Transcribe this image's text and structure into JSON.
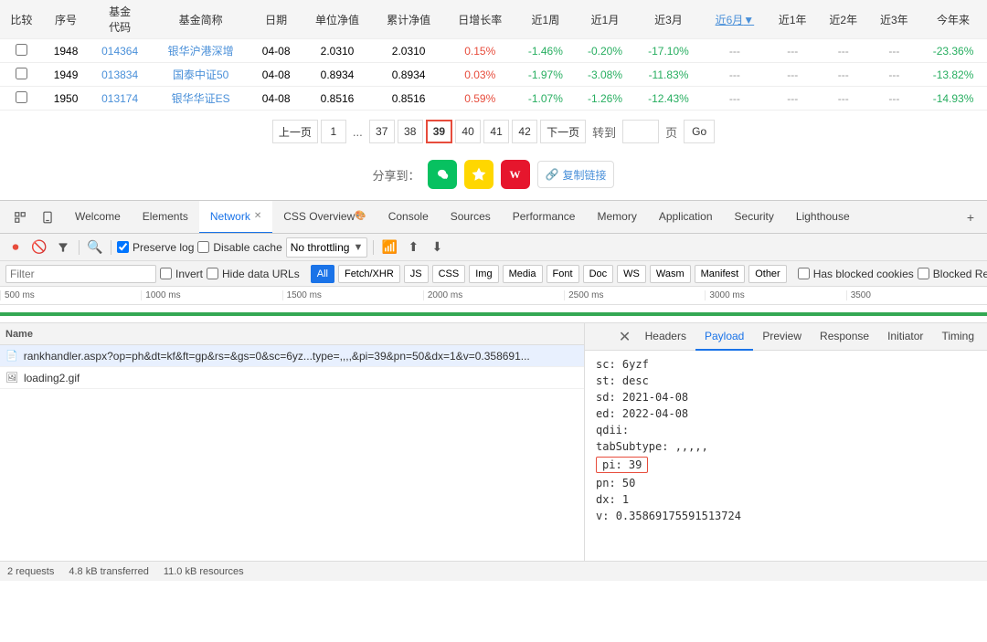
{
  "table": {
    "headers": [
      "比较",
      "序号",
      "基金代码",
      "基金简称",
      "日期",
      "单位净值",
      "累计净值",
      "日增长率",
      "近1周",
      "近1月",
      "近3月",
      "近6月",
      "近1年",
      "近2年",
      "近3年",
      "今年来"
    ],
    "rows": [
      {
        "compare": "",
        "seq": "1948",
        "code": "014364",
        "name": "银华沪港深增",
        "date": "04-08",
        "unit_nav": "2.0310",
        "accum_nav": "2.0310",
        "daily": "0.15%",
        "w1": "-1.46%",
        "m1": "-0.20%",
        "m3": "-17.10%",
        "m6": "---",
        "y1": "---",
        "y2": "---",
        "y3": "---",
        "ytd": "-23.36%"
      },
      {
        "compare": "",
        "seq": "1949",
        "code": "013834",
        "name": "国泰中证50",
        "date": "04-08",
        "unit_nav": "0.8934",
        "accum_nav": "0.8934",
        "daily": "0.03%",
        "w1": "-1.97%",
        "m1": "-3.08%",
        "m3": "-11.83%",
        "m6": "---",
        "y1": "---",
        "y2": "---",
        "y3": "---",
        "ytd": "-13.82%"
      },
      {
        "compare": "",
        "seq": "1950",
        "code": "013174",
        "name": "银华华证ES",
        "date": "04-08",
        "unit_nav": "0.8516",
        "accum_nav": "0.8516",
        "daily": "0.59%",
        "w1": "-1.07%",
        "m1": "-1.26%",
        "m3": "-12.43%",
        "m6": "---",
        "y1": "---",
        "y2": "---",
        "y3": "---",
        "ytd": "-14.93%"
      }
    ]
  },
  "pagination": {
    "prev": "上一页",
    "next": "下一页",
    "goto_label": "转到",
    "page_unit": "页",
    "go_btn": "Go",
    "pages": [
      "1",
      "...",
      "37",
      "38",
      "39",
      "40",
      "41",
      "42"
    ],
    "current": "39"
  },
  "share": {
    "label": "分享到：",
    "copy_text": "复制链接"
  },
  "devtools": {
    "tabs": [
      {
        "label": "Welcome",
        "active": false
      },
      {
        "label": "Elements",
        "active": false
      },
      {
        "label": "Network",
        "active": true,
        "closable": true
      },
      {
        "label": "CSS Overview",
        "active": false
      },
      {
        "label": "Console",
        "active": false
      },
      {
        "label": "Sources",
        "active": false
      },
      {
        "label": "Performance",
        "active": false
      },
      {
        "label": "Memory",
        "active": false
      },
      {
        "label": "Application",
        "active": false
      },
      {
        "label": "Security",
        "active": false
      },
      {
        "label": "Lighthouse",
        "active": false
      }
    ],
    "toolbar": {
      "preserve_log": "Preserve log",
      "disable_cache": "Disable cache",
      "throttling": "No throttling"
    },
    "filter": {
      "placeholder": "Filter",
      "invert": "Invert",
      "hide_data": "Hide data URLs",
      "all": "All",
      "fetch_xhr": "Fetch/XHR",
      "js": "JS",
      "css": "CSS",
      "img": "Img",
      "media": "Media",
      "font": "Font",
      "doc": "Doc",
      "ws": "WS",
      "wasm": "Wasm",
      "manifest": "Manifest",
      "other": "Other",
      "has_blocked": "Has blocked cookies",
      "blocked_re": "Blocked Re..."
    },
    "timeline": {
      "ticks": [
        "500 ms",
        "1000 ms",
        "1500 ms",
        "2000 ms",
        "2500 ms",
        "3000 ms",
        "3500"
      ]
    },
    "file_list": {
      "header": "Name",
      "files": [
        {
          "name": "rankhandler.aspx?op=ph&dt=kf&ft=gp&rs=&gs=0&sc=6yz...type=,,,,&pi=39&pn=50&dx=1&v=0.358691...",
          "type": "request",
          "selected": true
        },
        {
          "name": "loading2.gif",
          "type": "gif",
          "selected": false
        }
      ]
    },
    "details": {
      "tabs": [
        "Headers",
        "Payload",
        "Preview",
        "Response",
        "Initiator",
        "Timing"
      ],
      "active_tab": "Payload",
      "payload": {
        "sc": "6yzf",
        "st": "desc",
        "sd": "2021-04-08",
        "ed": "2022-04-08",
        "qdii": "",
        "tabSubtype": ",,,,,",
        "pi": "39",
        "pn": "50",
        "dx": "1",
        "v": "0.35869175591513724"
      }
    },
    "status": {
      "requests": "2 requests",
      "transferred": "4.8 kB transferred",
      "resources": "11.0 kB resources"
    }
  }
}
